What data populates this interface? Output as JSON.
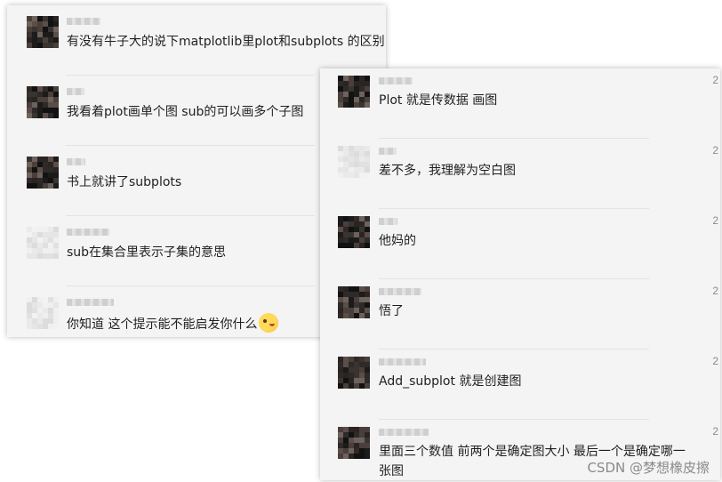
{
  "left_panel": {
    "messages": [
      {
        "text": "有没有牛子大的说下matplotlib里plot和subplots 的区别",
        "avatar": "dark"
      },
      {
        "text": "我看着plot画单个图 sub的可以画多个子图",
        "avatar": "dark"
      },
      {
        "text": "书上就讲了subplots",
        "avatar": "dark"
      },
      {
        "text": "sub在集合里表示子集的意思",
        "avatar": "light"
      },
      {
        "text": "你知道 这个提示能不能启发你什么",
        "avatar": "light",
        "emoji": "thinking-face-icon"
      }
    ]
  },
  "right_panel": {
    "messages": [
      {
        "text": "Plot 就是传数据 画图",
        "side": "2"
      },
      {
        "text": "差不多，我理解为空白图",
        "side": "2"
      },
      {
        "text": "他妈的",
        "side": "2"
      },
      {
        "text": "悟了",
        "side": "2"
      },
      {
        "text": "Add_subplot 就是创建图",
        "side": "2"
      },
      {
        "text": "里面三个数值 前两个是确定图大小 最后一个是确定哪一",
        "text2": "张图",
        "side": "2"
      }
    ]
  },
  "watermark": "CSDN @梦想橡皮擦"
}
